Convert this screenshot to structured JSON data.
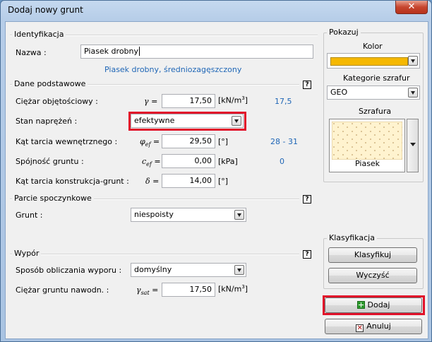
{
  "window": {
    "title": "Dodaj nowy grunt",
    "close_glyph": "✕"
  },
  "identyfikacja": {
    "legend": "Identyfikacja",
    "nazwa_label": "Nazwa :",
    "nazwa_value": "Piasek drobny",
    "description": "Piasek drobny, średniozagęszczony"
  },
  "dane": {
    "legend": "Dane podstawowe",
    "help": "?",
    "rows": [
      {
        "label": "Ciężar objętościowy :",
        "symbol": "γ",
        "sub": "",
        "value": "17,50",
        "unit": "[kN/m",
        "unit_sup": "3",
        "unit_end": "]",
        "hint": "17,5"
      },
      {
        "label": "Kąt tarcia wewnętrznego :",
        "symbol": "φ",
        "sub": "ef",
        "value": "29,50",
        "unit": "[°]",
        "unit_sup": "",
        "unit_end": "",
        "hint": "28 - 31"
      },
      {
        "label": "Spójność gruntu :",
        "symbol": "c",
        "sub": "ef",
        "value": "0,00",
        "unit": "[kPa]",
        "unit_sup": "",
        "unit_end": "",
        "hint": "0"
      },
      {
        "label": "Kąt tarcia konstrukcja-grunt :",
        "symbol": "δ",
        "sub": "",
        "value": "14,00",
        "unit": "[°]",
        "unit_sup": "",
        "unit_end": "",
        "hint": ""
      }
    ],
    "stan_label": "Stan naprężeń :",
    "stan_value": "efektywne"
  },
  "parcie": {
    "legend": "Parcie spoczynkowe",
    "help": "?",
    "grunt_label": "Grunt :",
    "grunt_value": "niespoisty"
  },
  "wypor": {
    "legend": "Wypór",
    "help": "?",
    "sposob_label": "Sposób obliczania wyporu :",
    "sposob_value": "domyślny",
    "ciezar_label": "Ciężar gruntu nawodn. :",
    "ciezar_symbol": "γ",
    "ciezar_sub": "sat",
    "ciezar_value": "17,50",
    "ciezar_unit": "[kN/m",
    "ciezar_unit_sup": "3",
    "ciezar_unit_end": "]"
  },
  "pokazuj": {
    "legend": "Pokazuj",
    "kolor_label": "Kolor",
    "kolor_value": "#f5b800",
    "kategorie_label": "Kategorie szrafur",
    "kategorie_value": "GEO",
    "szrafura_label": "Szrafura",
    "szrafura_name": "Piasek"
  },
  "klasyfikacja": {
    "legend": "Klasyfikacja",
    "klasyfikuj": "Klasyfikuj",
    "wyczysc": "Wyczyść"
  },
  "buttons": {
    "dodaj": "Dodaj",
    "anuluj": "Anuluj"
  },
  "colors": {
    "highlight": "#e1122a",
    "hint": "#1f66b6"
  }
}
